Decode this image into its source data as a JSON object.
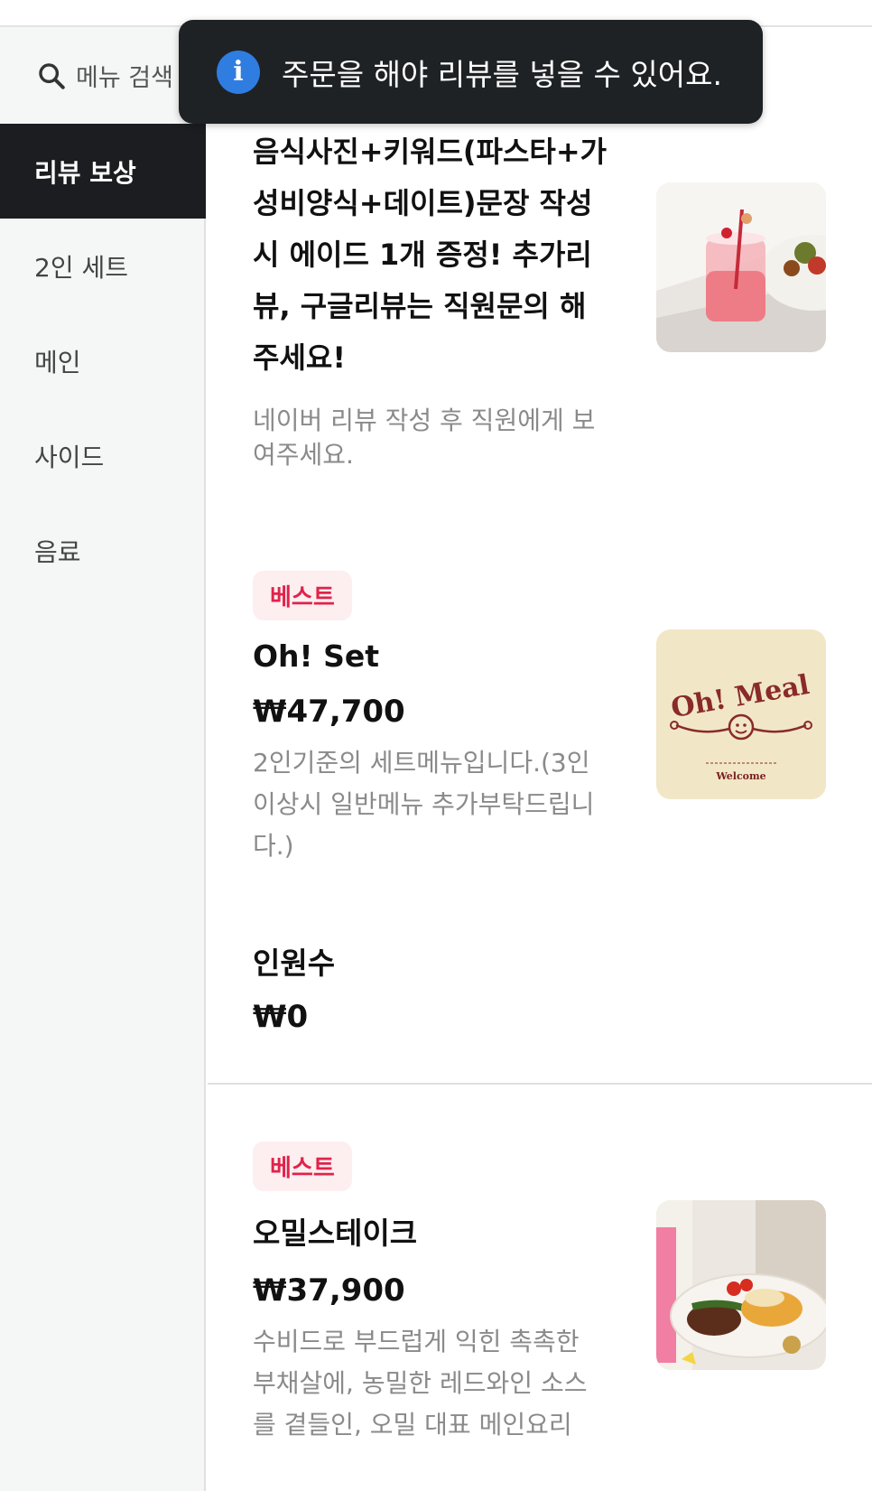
{
  "sidebar": {
    "search_placeholder": "메뉴 검색",
    "categories": [
      {
        "label": "리뷰 보상",
        "active": true
      },
      {
        "label": "2인 세트",
        "active": false
      },
      {
        "label": "메인",
        "active": false
      },
      {
        "label": "사이드",
        "active": false
      },
      {
        "label": "음료",
        "active": false
      }
    ]
  },
  "toast": {
    "message": "주문을 해야 리뷰를 넣을 수 있어요."
  },
  "items": [
    {
      "title": "음식사진+키워드(파스타+가성비양식+데이트)문장 작성시 에이드 1개 증정! 추가리뷰, 구글리뷰는 직원문의 해주세요!",
      "description": "네이버 리뷰 작성 후 직원에게 보여주세요."
    },
    {
      "badge": "베스트",
      "name": "Oh! Set",
      "price": "₩47,700",
      "description": "2인기준의 세트메뉴입니다.(3인이상시 일반메뉴 추가부탁드립니다.)",
      "option_label": "인원수",
      "option_price": "₩0",
      "image_logo_text": "Oh! Meal",
      "image_welcome_text": "Welcome"
    },
    {
      "badge": "베스트",
      "name": "오밀스테이크",
      "price": "₩37,900",
      "description": "수비드로 부드럽게 익힌 촉촉한 부채살에, 농밀한 레드와인 소스를 곁들인, 오밀 대표 메인요리"
    }
  ],
  "colors": {
    "accent_badge": "#e0234a",
    "badge_bg": "#fdeef0",
    "toast_bg": "#1f2225",
    "info_icon": "#2f7de1",
    "active_category_bg": "#1b1d20"
  },
  "icons": {
    "search": "search-icon",
    "info": "info-icon"
  }
}
